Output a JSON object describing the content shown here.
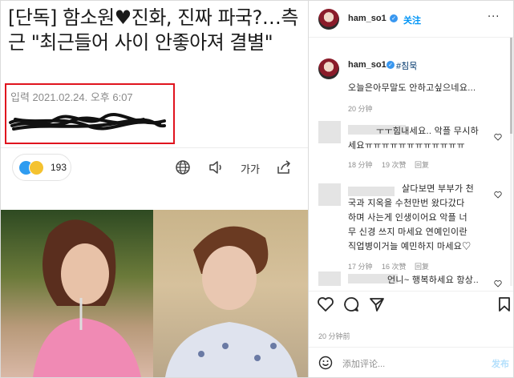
{
  "article": {
    "headline": "[단독] 함소원♥진화, 진짜 파국?…측근 \"최근들어 사이 안좋아져 결별\"",
    "dateline": "입력 2021.02.24. 오후 6:07",
    "reaction_count": "193",
    "font_size_label": "가가",
    "icons": [
      "globe-icon",
      "speaker-icon",
      "font-size-icon",
      "share-icon"
    ]
  },
  "post": {
    "header": {
      "username": "ham_so1",
      "follow_label": "关注",
      "more_label": "···"
    },
    "caption": {
      "username": "ham_so1",
      "hashtag": "#침묵",
      "text": "오늘은아무말도 안하고싶으네요...",
      "time": "20 分钟"
    },
    "comments": [
      {
        "line1": "ㅜㅜ힘내세요.. 악플 무시하",
        "line2": "세요ㅠㅠㅠㅠㅠㅠㅠㅠㅠㅠㅠㅠ",
        "time": "18 分钟",
        "likes": "19 次赞",
        "reply": "回复"
      },
      {
        "line1": "살다보면 부부가 천",
        "line2": "국과 지옥을 수천만번 왔다갔다",
        "line3": "하며 사는게 인생이어요 악플 너",
        "line4": "무 신경 쓰지 마세요 연예인이란",
        "line5": "직업병이거늘 예민하지 마세요♡",
        "time": "17 分钟",
        "likes": "16 次赞",
        "reply": "回复"
      },
      {
        "line1": "언니~ 행복하세요 항상.."
      }
    ],
    "post_time": "20 分钟前",
    "add_comment_placeholder": "添加评论...",
    "post_button": "发布",
    "icons": [
      "heart-icon",
      "comment-icon",
      "send-icon",
      "bookmark-icon",
      "smile-icon",
      "verified-icon"
    ]
  }
}
